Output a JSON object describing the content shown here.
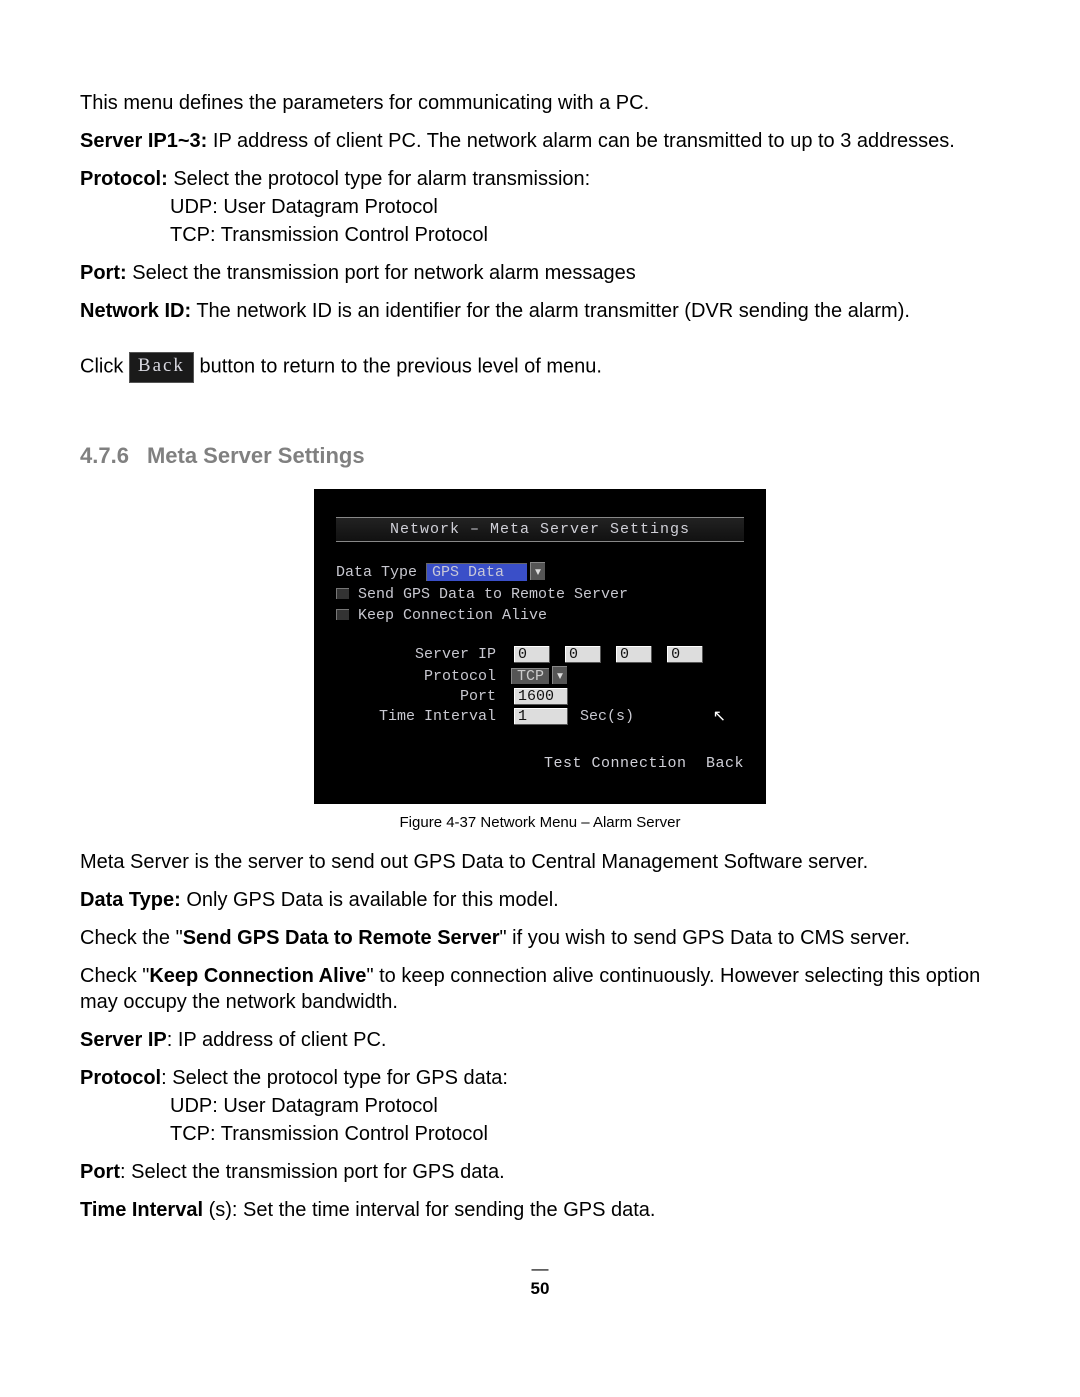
{
  "intro": "This menu defines the parameters for communicating with a PC.",
  "server_ip_label": "Server IP1~3:",
  "server_ip_text": " IP address of client PC. The network alarm can be transmitted to up to 3 addresses.",
  "protocol_label": "Protocol:",
  "protocol_text": " Select the protocol type for alarm transmission:",
  "protocol_udp": "UDP: User Datagram Protocol",
  "protocol_tcp": "TCP: Transmission Control Protocol",
  "port_label": "Port:",
  "port_text": " Select the transmission port for network alarm messages",
  "netid_label": "Network ID:",
  "netid_text": " The network ID is an identifier for the alarm transmitter (DVR sending the alarm).",
  "click_text1": "Click ",
  "back_btn": "Back",
  "click_text2": " button to return to the previous level of menu.",
  "section_num": "4.7.6",
  "section_title": "Meta Server Settings",
  "dvr": {
    "title": "Network – Meta Server Settings",
    "data_type_label": "Data Type",
    "data_type_value": "GPS Data",
    "cb1": "Send GPS Data to Remote Server",
    "cb2": "Keep Connection Alive",
    "serverip_label": "Server IP",
    "ip": [
      "0",
      "0",
      "0",
      "0"
    ],
    "protocol_label": "Protocol",
    "protocol_value": "TCP",
    "port_label": "Port",
    "port_value": "1600",
    "interval_label": "Time Interval",
    "interval_value": "1",
    "interval_unit": "Sec(s)",
    "footer_test": "Test Connection",
    "footer_back": "Back"
  },
  "caption": "Figure 4-37  Network Menu – Alarm Server",
  "meta_desc": "Meta Server is the server to send out GPS Data to Central Management Software server.",
  "dt_label": "Data Type:",
  "dt_text": " Only GPS Data is available for this model.",
  "check1_a": "Check the \"",
  "check1_b": "Send GPS Data to Remote Server",
  "check1_c": "\" if you wish to send GPS Data to CMS server.",
  "check2_a": "Check \"",
  "check2_b": "Keep Connection Alive",
  "check2_c": "\" to keep connection alive continuously. However selecting this option may occupy the network bandwidth.",
  "sip_label": "Server IP",
  "sip_text": ": IP address of client PC.",
  "proto2_label": "Protocol",
  "proto2_text": ": Select the protocol type for GPS data:",
  "proto2_udp": "UDP: User Datagram Protocol",
  "proto2_tcp": "TCP: Transmission Control Protocol",
  "port2_label": "Port",
  "port2_text": ": Select the transmission port for GPS data.",
  "ti_label": "Time Interval",
  "ti_text": " (s): Set the time interval for sending the GPS data.",
  "page_num": "50"
}
